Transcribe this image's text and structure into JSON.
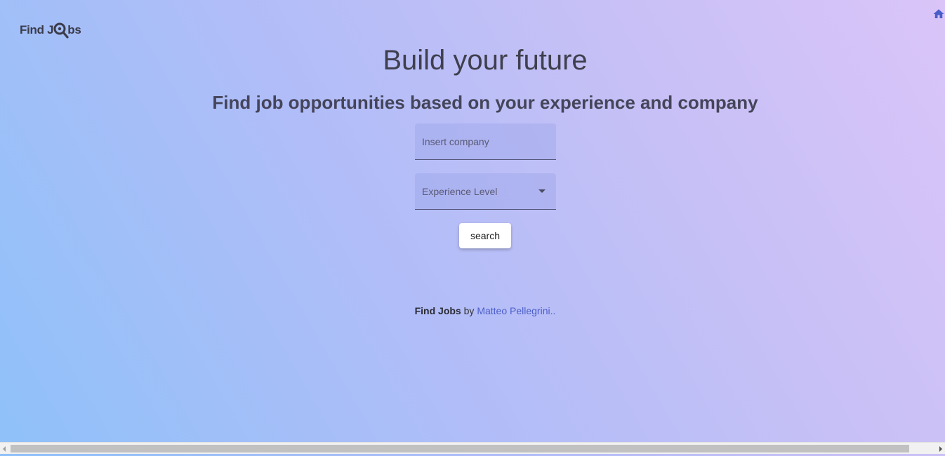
{
  "header": {
    "logo_text_before": "Find J",
    "logo_text_after": "bs",
    "home_icon": "home-icon"
  },
  "hero": {
    "title": "Build your future",
    "subtitle": "Find job opportunities based on your experience and company"
  },
  "form": {
    "company_placeholder": "Insert company",
    "company_value": "",
    "experience_label": "Experience Level",
    "search_label": "search"
  },
  "footer": {
    "brand": "Find Jobs",
    "by": " by ",
    "author": "Matteo Pellegrini.."
  },
  "colors": {
    "accent_link": "#4a5ec9",
    "home_icon": "#4a5ec9",
    "text_dark": "#3f3f4e"
  }
}
